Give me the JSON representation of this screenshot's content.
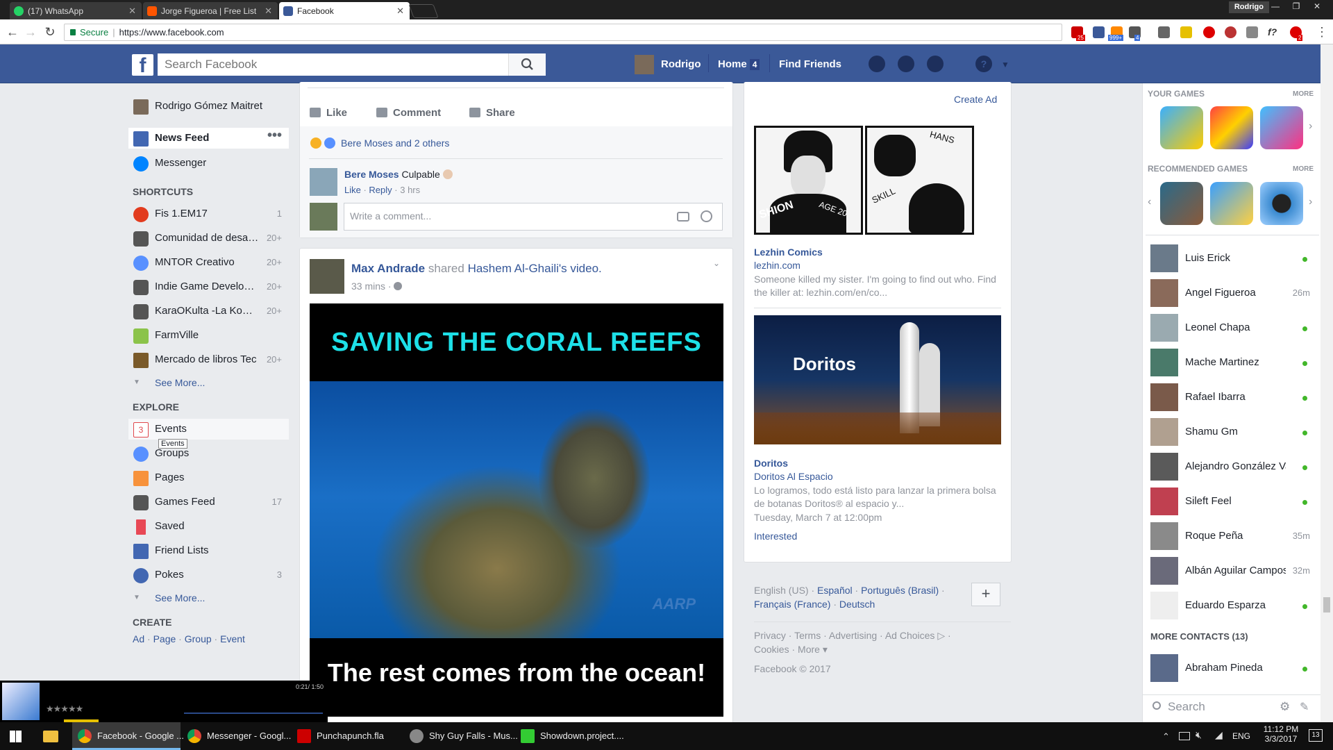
{
  "browser": {
    "tabs": [
      {
        "title": "(17) WhatsApp"
      },
      {
        "title": "Jorge Figueroa | Free List"
      },
      {
        "title": "Facebook"
      }
    ],
    "window_user": "Rodrigo",
    "secure_label": "Secure",
    "url": "https://www.facebook.com",
    "ext_badges": [
      "25",
      "999+",
      "4",
      "2"
    ]
  },
  "topbar": {
    "search_placeholder": "Search Facebook",
    "profile_name": "Rodrigo",
    "home_label": "Home",
    "home_badge": "4",
    "find_friends": "Find Friends"
  },
  "left_nav": {
    "profile_name": "Rodrigo Gómez Maitret",
    "news_feed": "News Feed",
    "messenger": "Messenger",
    "shortcuts_heading": "SHORTCUTS",
    "shortcuts": [
      {
        "label": "Fis 1.EM17",
        "count": "1"
      },
      {
        "label": "Comunidad de desarr...",
        "count": "20+"
      },
      {
        "label": "MNTOR Creativo",
        "count": "20+"
      },
      {
        "label": "Indie Game Developers",
        "count": "20+"
      },
      {
        "label": "KaraOKulta -La Komu...",
        "count": "20+"
      },
      {
        "label": "FarmVille",
        "count": ""
      },
      {
        "label": "Mercado de libros Tec",
        "count": "20+"
      }
    ],
    "see_more": "See More...",
    "explore_heading": "EXPLORE",
    "explore": [
      {
        "label": "Events",
        "count": ""
      },
      {
        "label": "Groups",
        "count": ""
      },
      {
        "label": "Pages",
        "count": ""
      },
      {
        "label": "Games Feed",
        "count": "17"
      },
      {
        "label": "Saved",
        "count": ""
      },
      {
        "label": "Friend Lists",
        "count": ""
      },
      {
        "label": "Pokes",
        "count": "3"
      }
    ],
    "events_icon_number": "3",
    "tooltip": "Events",
    "see_more_2": "See More...",
    "create_heading": "CREATE",
    "create_links": [
      "Ad",
      "Page",
      "Group",
      "Event"
    ]
  },
  "feed": {
    "post1": {
      "actions": [
        "Like",
        "Comment",
        "Share"
      ],
      "reactions_text": "Bere Moses and 2 others",
      "comment_author": "Bere Moses",
      "comment_text": "Culpable",
      "comment_like": "Like",
      "comment_reply": "Reply",
      "comment_time": "3 hrs",
      "comment_placeholder": "Write a comment..."
    },
    "post2": {
      "author": "Max Andrade",
      "shared_word": "shared",
      "source": "Hashem Al-Ghaili",
      "source_suffix": "'s",
      "video_word": "video.",
      "time": "33 mins",
      "video_title": "SAVING THE CORAL REEFS",
      "video_caption": "The rest comes from the ocean!",
      "watermark": "AARP"
    }
  },
  "ads": {
    "create_ad": "Create Ad",
    "ad1": {
      "title": "Lezhin Comics",
      "domain": "lezhin.com",
      "text": "Someone killed my sister. I'm going to find out who. Find the killer at: lezhin.com/en/co...",
      "art_text_1": "SHION",
      "art_text_2": "AGE 20",
      "art_text_3": "HANS",
      "art_text_4": "SKILL"
    },
    "ad2": {
      "title": "Doritos",
      "subtitle": "Doritos Al Espacio",
      "text": "Lo logramos, todo está listo para lanzar la primera bolsa de botanas Doritos® al espacio y...",
      "date": "Tuesday, March 7 at 12:00pm",
      "interested": "Interested",
      "brand": "Doritos"
    }
  },
  "footer": {
    "languages": [
      "English (US)",
      "Español",
      "Português (Brasil)",
      "Français (France)",
      "Deutsch"
    ],
    "links": [
      "Privacy",
      "Terms",
      "Advertising",
      "Ad Choices",
      "Cookies",
      "More"
    ],
    "copyright": "Facebook © 2017"
  },
  "sidebar": {
    "your_games": "YOUR GAMES",
    "recommended_games": "RECOMMENDED GAMES",
    "more": "MORE",
    "contacts": [
      {
        "name": "Luis Erick",
        "status": ""
      },
      {
        "name": "Angel Figueroa",
        "status": "26m"
      },
      {
        "name": "Leonel Chapa",
        "status": ""
      },
      {
        "name": "Mache Martinez",
        "status": ""
      },
      {
        "name": "Rafael Ibarra",
        "status": ""
      },
      {
        "name": "Shamu Gm",
        "status": ""
      },
      {
        "name": "Alejandro González Va...",
        "status": ""
      },
      {
        "name": "Sileft Feel",
        "status": ""
      },
      {
        "name": "Roque Peña",
        "status": "35m"
      },
      {
        "name": "Albán Aguilar Campos",
        "status": "32m"
      },
      {
        "name": "Eduardo Esparza",
        "status": ""
      }
    ],
    "more_contacts": "MORE CONTACTS (13)",
    "more_contacts_list": [
      {
        "name": "Abraham Pineda",
        "status": ""
      }
    ],
    "search_placeholder": "Search"
  },
  "player": {
    "time": "0:21/ 1:50"
  },
  "taskbar": {
    "items": [
      {
        "label": "Facebook - Google ..."
      },
      {
        "label": "Messenger - Googl..."
      },
      {
        "label": "Punchapunch.fla"
      },
      {
        "label": "Shy Guy Falls - Mus..."
      },
      {
        "label": "Showdown.project...."
      }
    ],
    "lang": "ENG",
    "time": "11:12 PM",
    "date": "3/3/2017",
    "notif_count": "13"
  },
  "colors": {
    "fb_blue": "#3b5998",
    "link": "#365899",
    "online": "#42b72a",
    "taskbar": "#101010"
  }
}
